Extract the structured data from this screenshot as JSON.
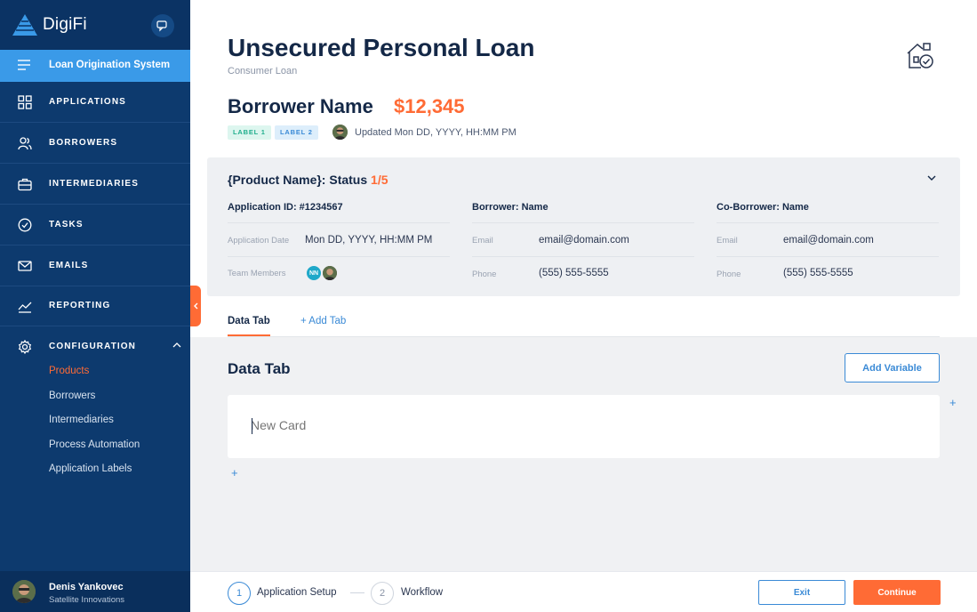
{
  "app": {
    "brand": "DigiFi"
  },
  "sidebar": {
    "system": "Loan Origination System",
    "items": [
      {
        "label": "APPLICATIONS",
        "icon": "grid-icon"
      },
      {
        "label": "BORROWERS",
        "icon": "users-icon"
      },
      {
        "label": "INTERMEDIARIES",
        "icon": "briefcase-icon"
      },
      {
        "label": "TASKS",
        "icon": "check-circle-icon"
      },
      {
        "label": "EMAILS",
        "icon": "mail-icon"
      },
      {
        "label": "REPORTING",
        "icon": "chart-line-icon"
      },
      {
        "label": "CONFIGURATION",
        "icon": "gear-icon"
      }
    ],
    "sub_items": [
      "Products",
      "Borrowers",
      "Intermediaries",
      "Process Automation",
      "Application Labels"
    ],
    "user": {
      "name": "Denis Yankovec",
      "org": "Satellite Innovations"
    }
  },
  "header": {
    "title": "Unsecured Personal Loan",
    "subtitle": "Consumer Loan",
    "borrower": "Borrower Name",
    "amount": "$12,345",
    "labels": [
      "LABEL 1",
      "LABEL 2"
    ],
    "updated": "Updated Mon DD, YYYY, HH:MM PM"
  },
  "panel": {
    "title_prefix": "{Product Name}: Status",
    "status": "1/5",
    "col1": {
      "heading": "Application ID: #1234567",
      "date_label": "Application Date",
      "date_value": "Mon DD, YYYY, HH:MM PM",
      "team_label": "Team Members",
      "team_initials": "NN"
    },
    "col2": {
      "heading": "Borrower: Name",
      "email_label": "Email",
      "email_value": "email@domain.com",
      "phone_label": "Phone",
      "phone_value": "(555) 555-5555"
    },
    "col3": {
      "heading": "Co-Borrower: Name",
      "email_label": "Email",
      "email_value": "email@domain.com",
      "phone_label": "Phone",
      "phone_value": "(555) 555-5555"
    }
  },
  "tabs": {
    "active": "Data Tab",
    "add": "+ Add Tab"
  },
  "work": {
    "title": "Data Tab",
    "add_variable": "Add Variable",
    "card_placeholder": "New Card",
    "plus": "+"
  },
  "footer": {
    "step1_num": "1",
    "step1_label": "Application Setup",
    "step2_num": "2",
    "step2_label": "Workflow",
    "exit": "Exit",
    "continue": "Continue"
  },
  "colors": {
    "accent": "#ff6b35",
    "primary": "#3a8ad6",
    "sidebar": "#0d3a6e"
  }
}
